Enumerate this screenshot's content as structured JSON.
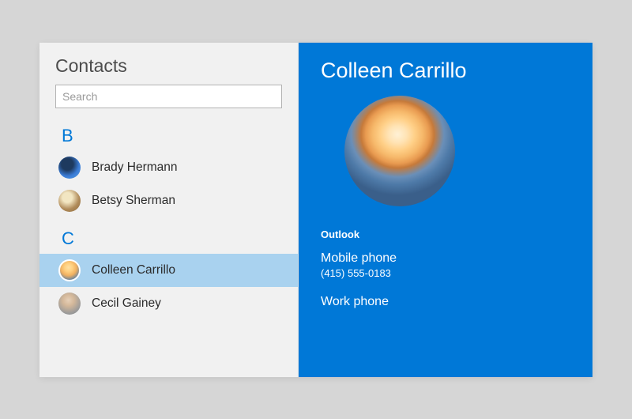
{
  "leftPane": {
    "title": "Contacts",
    "searchPlaceholder": "Search",
    "groups": [
      {
        "letter": "B",
        "items": [
          {
            "name": "Brady Hermann",
            "avatar": "av-b1",
            "selected": false
          },
          {
            "name": "Betsy Sherman",
            "avatar": "av-b2",
            "selected": false
          }
        ]
      },
      {
        "letter": "C",
        "items": [
          {
            "name": "Colleen Carrillo",
            "avatar": "av-c1",
            "selected": true
          },
          {
            "name": "Cecil Gainey",
            "avatar": "av-c2",
            "selected": false
          }
        ]
      }
    ]
  },
  "detail": {
    "name": "Colleen Carrillo",
    "source": "Outlook",
    "fields": [
      {
        "label": "Mobile phone",
        "value": "(415) 555-0183"
      },
      {
        "label": "Work phone",
        "value": ""
      }
    ]
  },
  "colors": {
    "accent": "#0078d7",
    "selection": "#a9d2ef"
  }
}
